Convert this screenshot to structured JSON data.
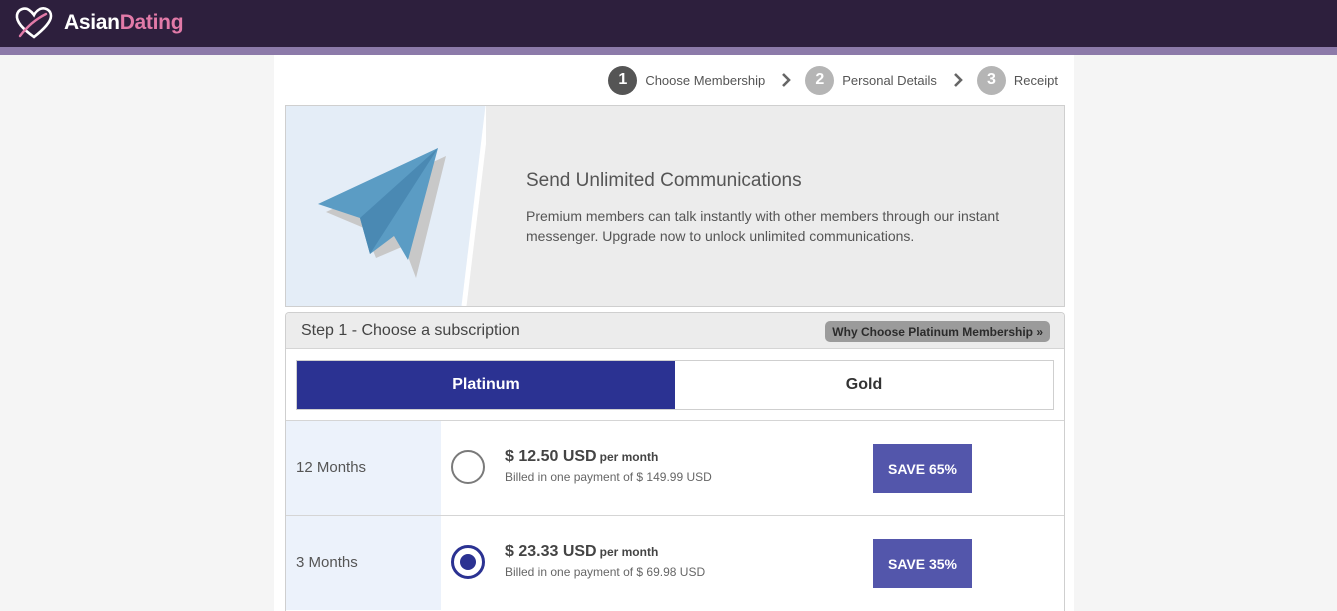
{
  "header": {
    "logo_part1": "Asian",
    "logo_part2": "Dating",
    "logo_icon": "heart-icon"
  },
  "steps": [
    {
      "number": "1",
      "label": "Choose Membership",
      "active": true
    },
    {
      "number": "2",
      "label": "Personal Details",
      "active": false
    },
    {
      "number": "3",
      "label": "Receipt",
      "active": false
    }
  ],
  "banner": {
    "icon": "paper-plane-icon",
    "title": "Send Unlimited Communications",
    "text": "Premium members can talk instantly with other members through our instant messenger. Upgrade now to unlock unlimited communications."
  },
  "subscription": {
    "title": "Step 1 - Choose a subscription",
    "why_button": "Why Choose Platinum Membership »",
    "tabs": [
      {
        "label": "Platinum",
        "active": true
      },
      {
        "label": "Gold",
        "active": false
      }
    ],
    "plans": [
      {
        "term": "12 Months",
        "price": "$ 12.50 USD",
        "per": "per month",
        "billed": "Billed in one payment of $ 149.99 USD",
        "save": "SAVE 65%",
        "selected": false
      },
      {
        "term": "3 Months",
        "price": "$ 23.33 USD",
        "per": "per month",
        "billed": "Billed in one payment of $ 69.98 USD",
        "save": "SAVE 35%",
        "selected": true
      }
    ]
  },
  "colors": {
    "header_bg": "#2d1f3d",
    "header_stripe": "#8c7aa9",
    "accent_navy": "#2b3292",
    "save_button": "#5356ab",
    "logo_pink": "#e27aa8"
  }
}
